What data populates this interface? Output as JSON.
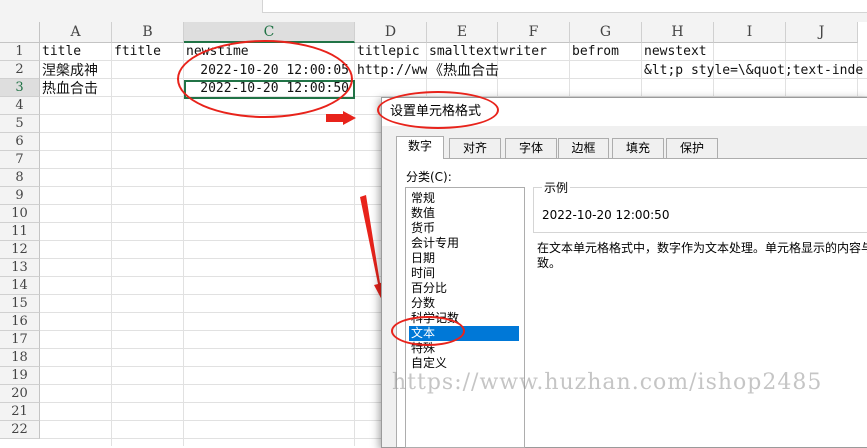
{
  "columns": [
    "A",
    "B",
    "C",
    "D",
    "E",
    "F",
    "G",
    "H",
    "I",
    "J"
  ],
  "rows": [
    "1",
    "2",
    "3",
    "4",
    "5",
    "6",
    "7",
    "8",
    "9",
    "10",
    "11",
    "12",
    "13",
    "14",
    "15",
    "16",
    "17",
    "18",
    "19",
    "20",
    "21",
    "22"
  ],
  "sheet": {
    "headers": {
      "A": "title",
      "B": "ftitle",
      "C": "newstime",
      "D": "titlepic",
      "E": "smalltext",
      "F": "writer",
      "G": "befrom",
      "H": "newstext"
    },
    "row2": {
      "A": "涅槃成神",
      "C": "2022-10-20 12:00:05",
      "D": "http://ww",
      "E": "《热血合击",
      "H": "&lt;p style=\\&quot;text-inde"
    },
    "row3": {
      "A": "热血合击",
      "C": "2022-10-20 12:00:50"
    }
  },
  "dialog": {
    "title": "设置单元格格式",
    "tabs": [
      "数字",
      "对齐",
      "字体",
      "边框",
      "填充",
      "保护"
    ],
    "category_label": "分类(C):",
    "categories": [
      "常规",
      "数值",
      "货币",
      "会计专用",
      "日期",
      "时间",
      "百分比",
      "分数",
      "科学记数",
      "文本",
      "特殊",
      "自定义"
    ],
    "selected_category": "文本",
    "sample_label": "示例",
    "sample_value": "2022-10-20 12:00:50",
    "description_line1": "在文本单元格格式中，数字作为文本处理。单元格显示的内容与",
    "description_line2": "致。"
  },
  "watermark": "https://www.huzhan.com/ishop2485",
  "colors": {
    "annotation": "#e8231b",
    "selection_green": "#217346",
    "list_highlight": "#0078d7"
  }
}
